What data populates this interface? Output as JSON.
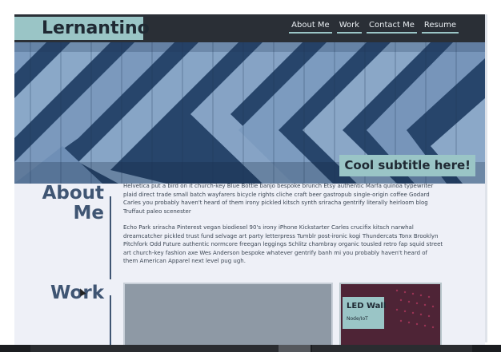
{
  "header": {
    "logo": "Lernantino"
  },
  "nav": {
    "items": [
      "About Me",
      "Work",
      "Contact Me",
      "Resume"
    ]
  },
  "hero": {
    "subtitle": "Cool subtitle here!"
  },
  "about": {
    "title_line1": "About",
    "title_line2": "Me",
    "paragraph1": "Helvetica put a bird on it church-key Blue Bottle banjo bespoke brunch Etsy authentic Marfa quinoa typewriter plaid direct trade small batch wayfarers bicycle rights cliche craft beer gastropub single-origin coffee Godard Carles you probably haven't heard of them irony pickled kitsch synth sriracha gentrify literally heirloom blog Truffaut paleo scenester",
    "paragraph2": "Echo Park sriracha Pinterest vegan biodiesel 90's irony iPhone Kickstarter Carles crucifix kitsch narwhal dreamcatcher pickled trust fund selvage art party letterpress Tumblr post-ironic kogi Thundercats Tonx Brooklyn Pitchfork Odd Future authentic normcore freegan leggings Schlitz chambray organic tousled retro fap squid street art church-key fashion axe Wes Anderson bespoke whatever gentrify banh mi you probably haven't heard of them American Apparel next level pug ugh."
  },
  "work": {
    "title": "Work",
    "card": {
      "title": "LED Wall",
      "subtitle": "Node/IoT"
    }
  },
  "colors": {
    "accent": "#9ac5c6",
    "topbar": "#2a2f36",
    "heading": "#3f5573",
    "page_bg": "#eef0f7"
  }
}
